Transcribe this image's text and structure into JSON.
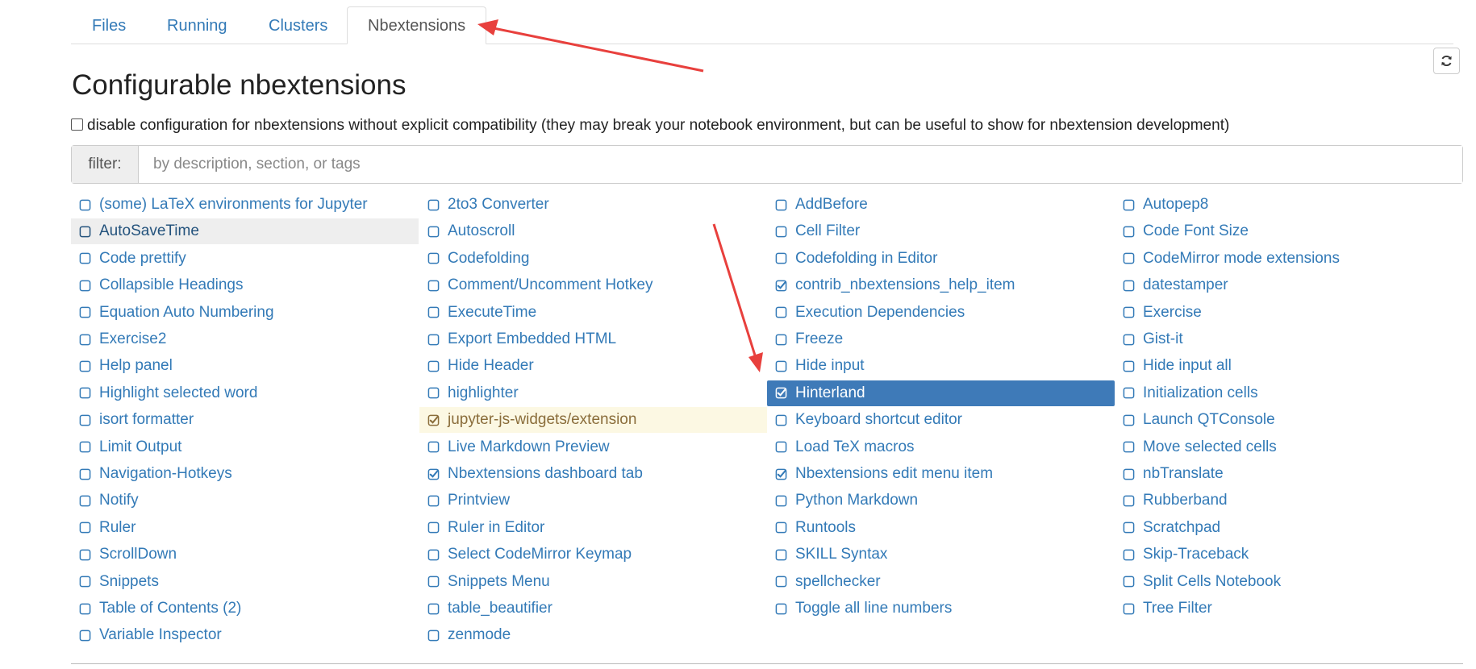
{
  "tabs": [
    {
      "label": "Files",
      "active": false
    },
    {
      "label": "Running",
      "active": false
    },
    {
      "label": "Clusters",
      "active": false
    },
    {
      "label": "Nbextensions",
      "active": true
    }
  ],
  "refresh_icon": "refresh-icon",
  "page_title": "Configurable nbextensions",
  "compat_label": "disable configuration for nbextensions without explicit compatibility (they may break your notebook environment, but can be useful to show for nbextension development)",
  "filter": {
    "label": "filter:",
    "placeholder": "by description, section, or tags",
    "value": ""
  },
  "colors": {
    "link": "#337ab7",
    "selected_bg": "#3e7ab8",
    "warning_bg": "#fcf8e3",
    "warning_text": "#8a6d3b",
    "hover_bg": "#eeeeee",
    "annotation_arrow": "#e8403d"
  },
  "extensions": [
    [
      {
        "label": "(some) LaTeX environments for Jupyter",
        "checked": false
      },
      {
        "label": "AutoSaveTime",
        "checked": false,
        "state": "hover"
      },
      {
        "label": "Code prettify",
        "checked": false
      },
      {
        "label": "Collapsible Headings",
        "checked": false
      },
      {
        "label": "Equation Auto Numbering",
        "checked": false
      },
      {
        "label": "Exercise2",
        "checked": false
      },
      {
        "label": "Help panel",
        "checked": false
      },
      {
        "label": "Highlight selected word",
        "checked": false
      },
      {
        "label": "isort formatter",
        "checked": false
      },
      {
        "label": "Limit Output",
        "checked": false
      },
      {
        "label": "Navigation-Hotkeys",
        "checked": false
      },
      {
        "label": "Notify",
        "checked": false
      },
      {
        "label": "Ruler",
        "checked": false
      },
      {
        "label": "ScrollDown",
        "checked": false
      },
      {
        "label": "Snippets",
        "checked": false
      },
      {
        "label": "Table of Contents (2)",
        "checked": false
      },
      {
        "label": "Variable Inspector",
        "checked": false
      }
    ],
    [
      {
        "label": "2to3 Converter",
        "checked": false
      },
      {
        "label": "Autoscroll",
        "checked": false
      },
      {
        "label": "Codefolding",
        "checked": false
      },
      {
        "label": "Comment/Uncomment Hotkey",
        "checked": false
      },
      {
        "label": "ExecuteTime",
        "checked": false
      },
      {
        "label": "Export Embedded HTML",
        "checked": false
      },
      {
        "label": "Hide Header",
        "checked": false
      },
      {
        "label": "highlighter",
        "checked": false
      },
      {
        "label": "jupyter-js-widgets/extension",
        "checked": true,
        "state": "warning"
      },
      {
        "label": "Live Markdown Preview",
        "checked": false
      },
      {
        "label": "Nbextensions dashboard tab",
        "checked": true
      },
      {
        "label": "Printview",
        "checked": false
      },
      {
        "label": "Ruler in Editor",
        "checked": false
      },
      {
        "label": "Select CodeMirror Keymap",
        "checked": false
      },
      {
        "label": "Snippets Menu",
        "checked": false
      },
      {
        "label": "table_beautifier",
        "checked": false
      },
      {
        "label": "zenmode",
        "checked": false
      }
    ],
    [
      {
        "label": "AddBefore",
        "checked": false
      },
      {
        "label": "Cell Filter",
        "checked": false
      },
      {
        "label": "Codefolding in Editor",
        "checked": false
      },
      {
        "label": "contrib_nbextensions_help_item",
        "checked": true
      },
      {
        "label": "Execution Dependencies",
        "checked": false
      },
      {
        "label": "Freeze",
        "checked": false
      },
      {
        "label": "Hide input",
        "checked": false
      },
      {
        "label": "Hinterland",
        "checked": true,
        "state": "selected"
      },
      {
        "label": "Keyboard shortcut editor",
        "checked": false
      },
      {
        "label": "Load TeX macros",
        "checked": false
      },
      {
        "label": "Nbextensions edit menu item",
        "checked": true
      },
      {
        "label": "Python Markdown",
        "checked": false
      },
      {
        "label": "Runtools",
        "checked": false
      },
      {
        "label": "SKILL Syntax",
        "checked": false
      },
      {
        "label": "spellchecker",
        "checked": false
      },
      {
        "label": "Toggle all line numbers",
        "checked": false
      }
    ],
    [
      {
        "label": "Autopep8",
        "checked": false
      },
      {
        "label": "Code Font Size",
        "checked": false
      },
      {
        "label": "CodeMirror mode extensions",
        "checked": false
      },
      {
        "label": "datestamper",
        "checked": false
      },
      {
        "label": "Exercise",
        "checked": false
      },
      {
        "label": "Gist-it",
        "checked": false
      },
      {
        "label": "Hide input all",
        "checked": false
      },
      {
        "label": "Initialization cells",
        "checked": false
      },
      {
        "label": "Launch QTConsole",
        "checked": false
      },
      {
        "label": "Move selected cells",
        "checked": false
      },
      {
        "label": "nbTranslate",
        "checked": false
      },
      {
        "label": "Rubberband",
        "checked": false
      },
      {
        "label": "Scratchpad",
        "checked": false
      },
      {
        "label": "Skip-Traceback",
        "checked": false
      },
      {
        "label": "Split Cells Notebook",
        "checked": false
      },
      {
        "label": "Tree Filter",
        "checked": false
      }
    ]
  ]
}
